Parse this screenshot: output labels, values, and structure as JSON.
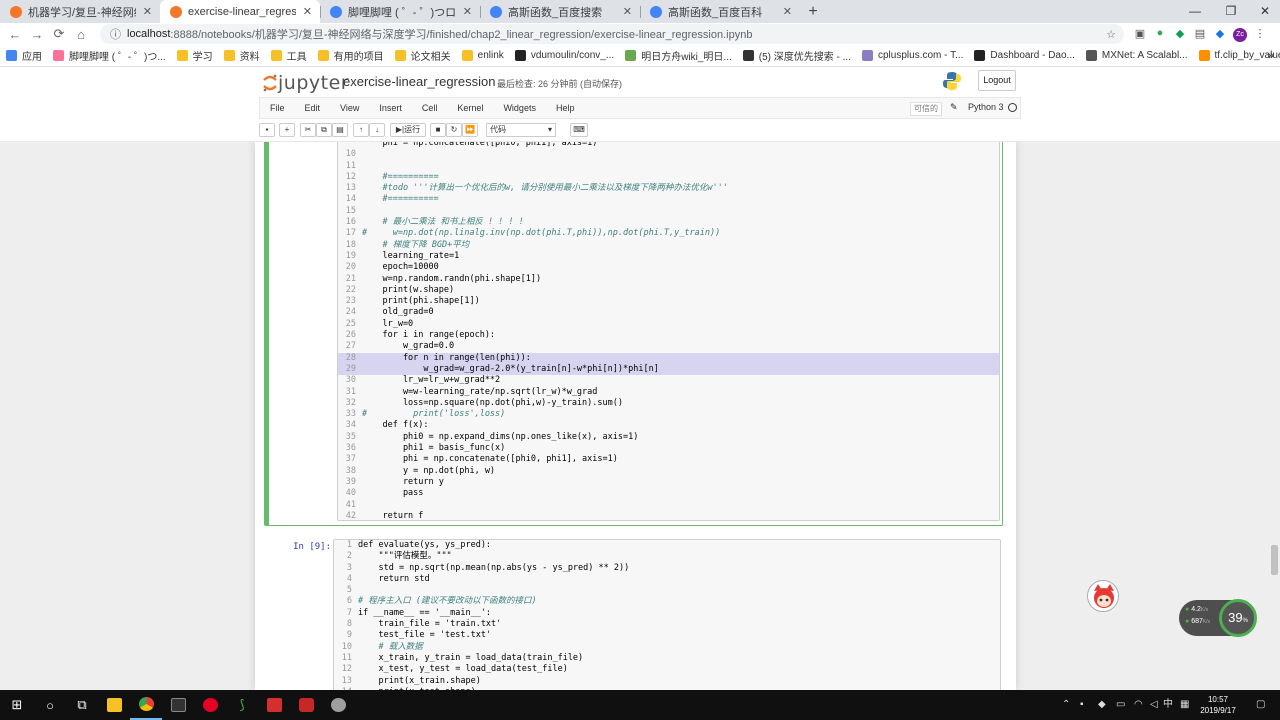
{
  "browser": {
    "tabs": [
      {
        "title": "机器学习/复旦-神经网络与深度学",
        "active": false,
        "favicon": "orange"
      },
      {
        "title": "exercise-linear_regression - Ju",
        "active": true,
        "favicon": "orange"
      },
      {
        "title": "脚哩脚哩 ( ゜- ゜)つロ 干杯~-bili",
        "active": false,
        "favicon": "blue"
      },
      {
        "title": "高斯函数_百度搜索",
        "active": false,
        "favicon": "blue"
      },
      {
        "title": "高斯函数_百度百科",
        "active": false,
        "favicon": "blue"
      }
    ],
    "new_tab": "+",
    "window_controls": {
      "minimize": "—",
      "restore": "❐",
      "close": "✕"
    },
    "url": "localhost:8888/notebooks/机器学习/复旦-神经网络与深度学习/finished/chap2_linear_regression/exercise-linear_regression.ipynb",
    "url_host": "localhost",
    "url_rest": ":8888/notebooks/机器学习/复旦-神经网络与深度学习/finished/chap2_linear_regression/exercise-linear_regression.ipynb",
    "bookmarks": [
      {
        "label": "应用",
        "color": "#4285f4"
      },
      {
        "label": "脚哩脚哩 ( ゜- ゜)つ...",
        "color": "#fb7299"
      },
      {
        "label": "学习",
        "color": "#f6c026"
      },
      {
        "label": "资料",
        "color": "#f6c026"
      },
      {
        "label": "工具",
        "color": "#f6c026"
      },
      {
        "label": "有用的项目",
        "color": "#f6c026"
      },
      {
        "label": "论文相关",
        "color": "#f6c026"
      },
      {
        "label": "enlink",
        "color": "#f6c026"
      },
      {
        "label": "vdumoulin/conv_...",
        "color": "#222"
      },
      {
        "label": "明日方舟wiki_明日...",
        "color": "#6aa84f"
      },
      {
        "label": "(5) 深度优先搜索 - ...",
        "color": "#333"
      },
      {
        "label": "cplusplus.com - T...",
        "color": "#8e7cc3"
      },
      {
        "label": "Dashboard - Dao...",
        "color": "#222"
      },
      {
        "label": "MXNet: A Scalabl...",
        "color": "#555"
      },
      {
        "label": "tf.clip_by_value |...",
        "color": "#ff8f00"
      }
    ],
    "bookmarks_more": "»"
  },
  "jupyter": {
    "logo_text": "jupyter",
    "notebook_name": "exercise-linear_regression",
    "checkpoint": "最后检查: 26 分钟前 (自动保存)",
    "logout": "Logout",
    "menu": [
      "File",
      "Edit",
      "View",
      "Insert",
      "Cell",
      "Kernel",
      "Widgets",
      "Help"
    ],
    "trusted": "可信的",
    "kernel": "Python 3",
    "run_label": "运行",
    "cell_type": "代码",
    "toolbar_icons": [
      "save-icon",
      "add-cell-icon",
      "cut-icon",
      "copy-icon",
      "paste-icon",
      "move-up-icon",
      "move-down-icon",
      "run-icon",
      "stop-icon",
      "restart-icon",
      "fast-forward-icon",
      "keyboard-icon"
    ]
  },
  "cells": [
    {
      "prompt": "",
      "lines": [
        {
          "n": "",
          "text": "    phi = np.concatenate([phi0, phi1], axis=1)"
        },
        {
          "n": "10",
          "text": ""
        },
        {
          "n": "11",
          "text": ""
        },
        {
          "n": "12",
          "text": "    #=========="
        },
        {
          "n": "13",
          "text": "    #todo '''计算出一个优化后的w, 请分别使用最小二乘法以及梯度下降两种办法优化w'''"
        },
        {
          "n": "14",
          "text": "    #=========="
        },
        {
          "n": "15",
          "text": ""
        },
        {
          "n": "16",
          "text": "    # 最小二乘法 和书上相反 ! ! ! !"
        },
        {
          "n": "17",
          "text": "#     w=np.dot(np.linalg.inv(np.dot(phi.T,phi)),np.dot(phi.T,y_train))"
        },
        {
          "n": "18",
          "text": "    # 梯度下降 BGD+平均"
        },
        {
          "n": "19",
          "text": "    learning_rate=1"
        },
        {
          "n": "20",
          "text": "    epoch=10000"
        },
        {
          "n": "21",
          "text": "    w=np.random.randn(phi.shape[1])"
        },
        {
          "n": "22",
          "text": "    print(w.shape)"
        },
        {
          "n": "23",
          "text": "    print(phi.shape[1])"
        },
        {
          "n": "24",
          "text": "    old_grad=0"
        },
        {
          "n": "25",
          "text": "    lr_w=0"
        },
        {
          "n": "26",
          "text": "    for i in range(epoch):"
        },
        {
          "n": "27",
          "text": "        w_grad=0.0"
        },
        {
          "n": "28",
          "text": "        for n in range(len(phi)):",
          "hl": true
        },
        {
          "n": "29",
          "text": "            w_grad=w_grad-2.0*(y_train[n]-w*phi[n])*phi[n]",
          "hl": true
        },
        {
          "n": "30",
          "text": "        lr_w=lr_w+w_grad**2"
        },
        {
          "n": "31",
          "text": "        w=w-learning_rate/np.sqrt(lr_w)*w_grad"
        },
        {
          "n": "32",
          "text": "        loss=np.square(np.dot(phi,w)-y_train).sum()"
        },
        {
          "n": "33",
          "text": "#         print('loss',loss)"
        },
        {
          "n": "34",
          "text": "    def f(x):"
        },
        {
          "n": "35",
          "text": "        phi0 = np.expand_dims(np.ones_like(x), axis=1)"
        },
        {
          "n": "36",
          "text": "        phi1 = basis_func(x)"
        },
        {
          "n": "37",
          "text": "        phi = np.concatenate([phi0, phi1], axis=1)"
        },
        {
          "n": "38",
          "text": "        y = np.dot(phi, w)"
        },
        {
          "n": "39",
          "text": "        return y"
        },
        {
          "n": "40",
          "text": "        pass"
        },
        {
          "n": "41",
          "text": ""
        },
        {
          "n": "42",
          "text": "    return f"
        }
      ]
    },
    {
      "prompt": "In  [9]:",
      "lines": [
        {
          "n": "1",
          "text": "def evaluate(ys, ys_pred):"
        },
        {
          "n": "2",
          "text": "    \"\"\"评估模型。\"\"\""
        },
        {
          "n": "3",
          "text": "    std = np.sqrt(np.mean(np.abs(ys - ys_pred) ** 2))"
        },
        {
          "n": "4",
          "text": "    return std"
        },
        {
          "n": "5",
          "text": ""
        },
        {
          "n": "6",
          "text": "# 程序主入口 (建议不要改动以下函数的接口)"
        },
        {
          "n": "7",
          "text": "if __name__ == '__main__':"
        },
        {
          "n": "8",
          "text": "    train_file = 'train.txt'"
        },
        {
          "n": "9",
          "text": "    test_file = 'test.txt'"
        },
        {
          "n": "10",
          "text": "    # 载入数据"
        },
        {
          "n": "11",
          "text": "    x_train, y_train = load_data(train_file)"
        },
        {
          "n": "12",
          "text": "    x_test, y_test = load_data(test_file)"
        },
        {
          "n": "13",
          "text": "    print(x_train.shape)"
        },
        {
          "n": "14",
          "text": "    print(x_test.shape)"
        }
      ]
    }
  ],
  "overlays": {
    "net_up": "4.2",
    "net_up_unit": "K/s",
    "net_down": "687",
    "net_down_unit": "K/s",
    "cpu_percent": "39",
    "cpu_unit": "%"
  },
  "taskbar": {
    "clock_time": "10:57",
    "clock_date": "2019/9/17",
    "ime": "中",
    "tray_icons": [
      "chevron-up-icon",
      "network-icon",
      "volume-icon",
      "ime-icon",
      "notification-icon"
    ]
  },
  "colors": {
    "jupyter_orange": "#f37726",
    "select_green": "#66bb6a",
    "select_blue": "#42a5f5",
    "prompt_blue": "#303f9f"
  }
}
